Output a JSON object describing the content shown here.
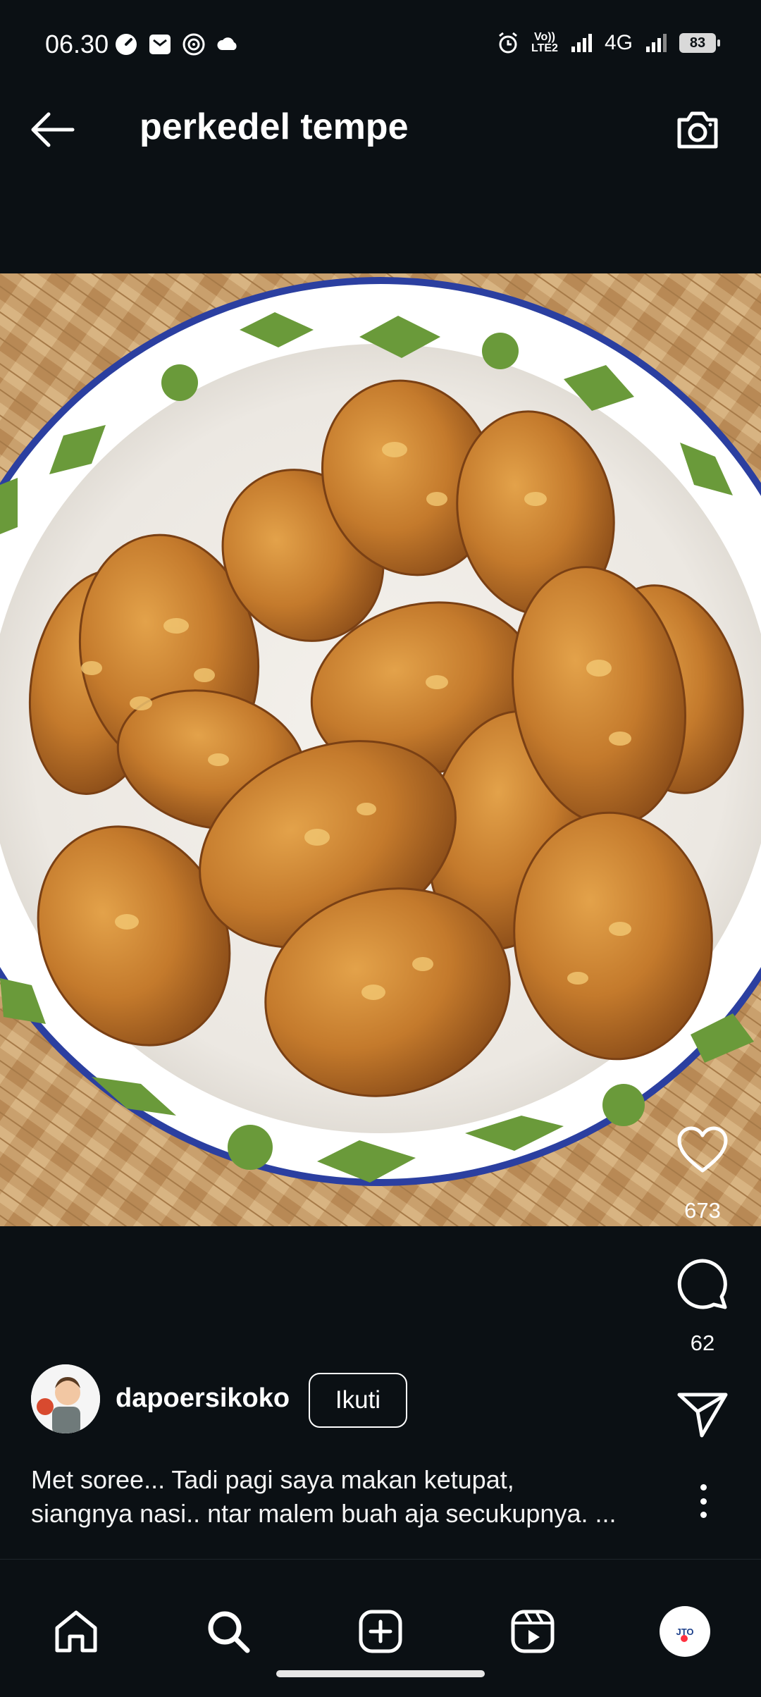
{
  "status_bar": {
    "time": "06.30",
    "lte_label": "Vo)) LTE2",
    "network": "4G",
    "battery": "83"
  },
  "header": {
    "title": "perkedel tempe",
    "back_icon": "arrow-left-icon",
    "camera_icon": "camera-icon"
  },
  "post": {
    "likes": "673",
    "comments": "62",
    "author": "dapoersikoko",
    "follow_label": "Ikuti",
    "caption_line1": "Met soree... Tadi pagi saya makan ketupat,",
    "caption_line2": "siangnya nasi.. ntar malem buah aja secukupnya. ..."
  },
  "bottom_nav": {
    "items": [
      "home-icon",
      "search-icon",
      "create-icon",
      "reels-icon",
      "profile-avatar"
    ],
    "profile_initials": "JTO"
  },
  "colors": {
    "background": "#0b1014",
    "text": "#ffffff",
    "notification_dot": "#ff3040"
  }
}
